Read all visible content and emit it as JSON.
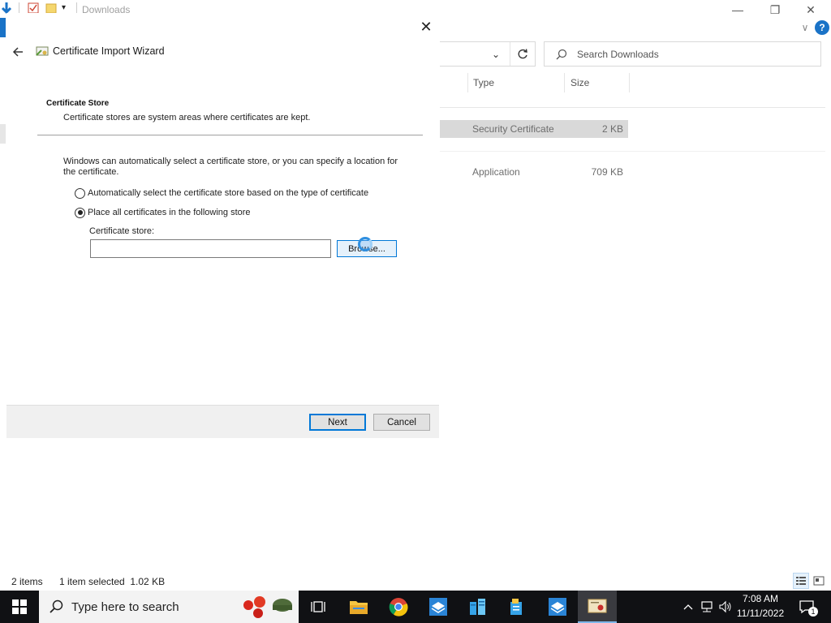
{
  "explorer": {
    "title": "Downloads",
    "search_placeholder": "Search Downloads",
    "columns": {
      "type": "Type",
      "size": "Size"
    },
    "rows": [
      {
        "type": "Security Certificate",
        "size": "2 KB",
        "selected": true
      },
      {
        "type": "Application",
        "size": "709 KB",
        "selected": false
      }
    ],
    "status": {
      "items": "2 items",
      "selected": "1 item selected  1.02 KB"
    },
    "window_controls": {
      "minimize": "—",
      "restore": "❐",
      "close": "✕"
    }
  },
  "wizard": {
    "title": "Certificate Import Wizard",
    "close": "✕",
    "section_title": "Certificate Store",
    "section_desc": "Certificate stores are system areas where certificates are kept.",
    "intro": "Windows can automatically select a certificate store, or you can specify a location for the certificate.",
    "options": [
      {
        "label": "Automatically select the certificate store based on the type of certificate",
        "checked": false
      },
      {
        "label": "Place all certificates in the following store",
        "checked": true
      }
    ],
    "store_label": "Certificate store:",
    "store_value": "",
    "browse_label": "Browse...",
    "next_label": "Next",
    "cancel_label": "Cancel"
  },
  "taskbar": {
    "search_placeholder": "Type here to search",
    "time": "7:08 AM",
    "date": "11/11/2022",
    "notification_count": "1"
  },
  "colors": {
    "accent": "#0078d7",
    "taskbar": "#101114",
    "selection": "#d9d9d9"
  }
}
